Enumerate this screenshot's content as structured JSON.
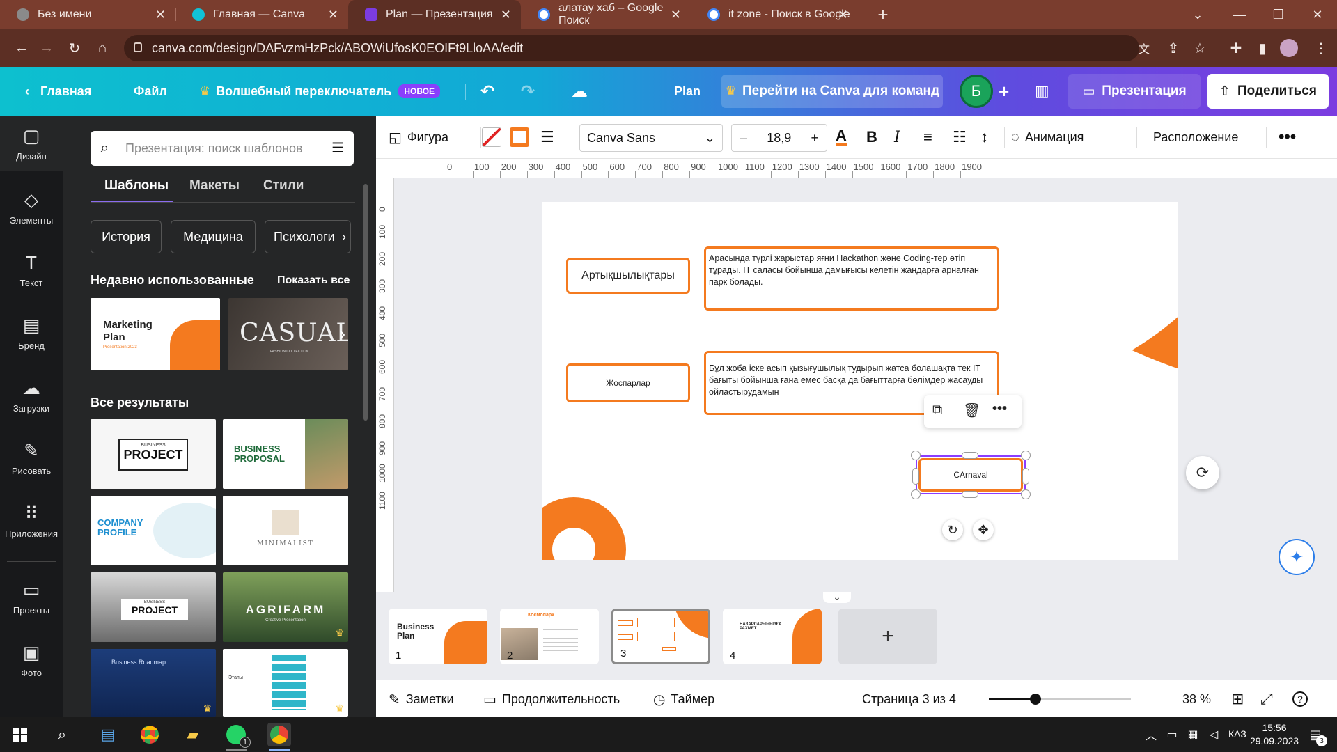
{
  "browser": {
    "tabs": [
      {
        "title": "Без имени",
        "color": "#8a8a8a"
      },
      {
        "title": "Главная — Canva",
        "color": "#11c1d6"
      },
      {
        "title": "Plan — Презентация",
        "color": "#7b3ce0"
      },
      {
        "title": "алатау хаб – Google Поиск",
        "color": "#4285f4"
      },
      {
        "title": "it zone - Поиск в Google",
        "color": "#4285f4"
      }
    ],
    "url": "canva.com/design/DAFvzmHzPck/ABOWiUfosK0EOIFt9LloAA/edit"
  },
  "canva_top": {
    "home": "Главная",
    "file": "Файл",
    "magic": "Волшебный переключатель",
    "new_badge": "НОВОЕ",
    "doc_title": "Plan",
    "teams": "Перейти на Canva для команд",
    "avatar_letter": "Б",
    "present": "Презентация",
    "share": "Поделиться"
  },
  "rail": [
    {
      "label": "Дизайн",
      "icon": "▢"
    },
    {
      "label": "Элементы",
      "icon": "◇"
    },
    {
      "label": "Текст",
      "icon": "T"
    },
    {
      "label": "Бренд",
      "icon": "▤"
    },
    {
      "label": "Загрузки",
      "icon": "☁"
    },
    {
      "label": "Рисовать",
      "icon": "✎"
    },
    {
      "label": "Приложения",
      "icon": "⠿"
    },
    {
      "label": "Проекты",
      "icon": "▭"
    },
    {
      "label": "Фото",
      "icon": "▣"
    }
  ],
  "panel": {
    "search_placeholder": "Презентация: поиск шаблонов",
    "tabs": [
      "Шаблоны",
      "Макеты",
      "Стили"
    ],
    "chips": [
      "История",
      "Медицина",
      "Психологи"
    ],
    "recent_title": "Недавно использованные",
    "show_all": "Показать все",
    "recent": [
      {
        "line1": "Marketing",
        "line2": "Plan",
        "sub": "Presentation 2023"
      },
      {
        "line1": "CASUAL",
        "sub": "FASHION COLLECTION"
      }
    ],
    "results_title": "Все результаты",
    "results": [
      {
        "title": "PROJECT",
        "sub": "BUSINESS"
      },
      {
        "title": "BUSINESS PROPOSAL"
      },
      {
        "title": "COMPANY PROFILE"
      },
      {
        "title": "MINIMALIST"
      },
      {
        "title": "PROJECT",
        "sub": "BUSINESS"
      },
      {
        "title": "AGRIFARM",
        "sub": "Creative Presentation"
      },
      {
        "title": "Business Roadmap"
      },
      {
        "title": "Этапы"
      }
    ]
  },
  "editor_toolbar": {
    "shape": "Фигура",
    "font": "Canva Sans",
    "size": "18,9",
    "animation": "Анимация",
    "arrange": "Расположение"
  },
  "ruler": [
    "0",
    "100",
    "200",
    "300",
    "400",
    "500",
    "600",
    "700",
    "800",
    "900",
    "1000",
    "1100",
    "1200",
    "1300",
    "1400",
    "1500",
    "1600",
    "1700",
    "1800",
    "1900"
  ],
  "ruler_v": [
    "0",
    "100",
    "200",
    "300",
    "400",
    "500",
    "600",
    "700",
    "800",
    "900",
    "1000",
    "1100"
  ],
  "slide": {
    "box1_label": "Артықшылықтары",
    "box1_text": "Арасында түрлі жарыстар яғни Hackathon және Coding-тер өтіп тұрады. IT саласы бойынша дамығысы келетін жандарға арналған парк болады.",
    "box2_label": "Жоспарлар",
    "box2_text": "Бұл жоба іске асып қызығушылық тудырып жатса болашақта тек IT бағыты бойынша ғана емес басқа да бағыттарға бөлімдер жасауды ойластырудамын",
    "selected_text": "CArnaval"
  },
  "pages": [
    {
      "num": "1",
      "title": "Business Plan"
    },
    {
      "num": "2",
      "title": "Космопарк"
    },
    {
      "num": "3"
    },
    {
      "num": "4",
      "title": "НАЗАРЛАРЫҢЫЗҒА РАХМЕТ"
    }
  ],
  "status": {
    "notes": "Заметки",
    "duration": "Продолжительность",
    "timer": "Таймер",
    "page": "Страница 3 из 4",
    "zoom": "38 %",
    "zoom_level": 0.33
  },
  "taskbar": {
    "lang": "КАЗ",
    "time": "15:56",
    "date": "29.09.2023",
    "notif": "3",
    "whatsapp_badge": "1"
  },
  "colors": {
    "accent_orange": "#f47a1f",
    "canva_teal": "#0dc0cf",
    "canva_purple": "#7b3ce0"
  }
}
